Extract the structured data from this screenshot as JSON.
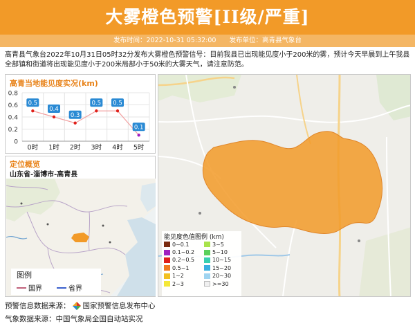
{
  "header": {
    "title": "大雾橙色预警[II级/严重]",
    "publish_time": "发布时间：2022-10-31 05:32:00",
    "publisher": "发布单位：高青县气象台"
  },
  "description": "高青县气象台2022年10月31日05时32分发布大雾橙色预警信号：目前我县已出现能见度小于200米的雾，预计今天早晨到上午我县全部镇和街道将出现能见度小于200米局部小于50米的大雾天气，请注意防范。",
  "visibility_panel": {
    "title": "高青当地能见度实况(km)"
  },
  "location_panel": {
    "title": "定位概览",
    "location": "山东省-淄博市-高青县",
    "legend_title": "图例",
    "legend_items": [
      {
        "label": "国界",
        "color": "#c0607a"
      },
      {
        "label": "省界",
        "color": "#3a5fcd"
      }
    ]
  },
  "color_legend": {
    "title": "能见度色值图例 (km)",
    "items": [
      {
        "label": "0~0.1",
        "color": "#7b2c10"
      },
      {
        "label": "3~5",
        "color": "#a9e34b"
      },
      {
        "label": "0.1~0.2",
        "color": "#a020c0"
      },
      {
        "label": "5~10",
        "color": "#5ad05a"
      },
      {
        "label": "0.2~0.5",
        "color": "#e0201a"
      },
      {
        "label": "10~15",
        "color": "#38d0b0"
      },
      {
        "label": "0.5~1",
        "color": "#f07a20"
      },
      {
        "label": "15~20",
        "color": "#3ab0e0"
      },
      {
        "label": "1~2",
        "color": "#f2c020"
      },
      {
        "label": "20~30",
        "color": "#9fd4f0"
      },
      {
        "label": "2~3",
        "color": "#f4e838"
      },
      {
        "label": ">=30",
        "color": "#f0f0f0"
      }
    ]
  },
  "sources": {
    "warning_source": "预警信息数据来源：",
    "warning_source_name": "国家预警信息发布中心",
    "weather_source": "气象数据来源：中国气象局全国自动站实况"
  },
  "chart_data": {
    "type": "line",
    "title": "高青当地能见度实况(km)",
    "categories": [
      "0时",
      "1时",
      "2时",
      "3时",
      "4时",
      "5时"
    ],
    "values": [
      0.5,
      0.4,
      0.3,
      0.5,
      0.5,
      0.1
    ],
    "data_labels": [
      "0.5",
      "0.4",
      "0.3",
      "0.5",
      "0.5",
      "0.1"
    ],
    "ylim": [
      0,
      0.8
    ],
    "yticks": [
      "0",
      "0.2",
      "0.4",
      "0.6",
      "0.8"
    ],
    "grid": true,
    "line_color": "#f2a0a0",
    "point_colors": [
      "#e0201a",
      "#e0201a",
      "#e0201a",
      "#e0201a",
      "#e0201a",
      "#a020c0"
    ],
    "label_bg": "#2a8ad4"
  }
}
